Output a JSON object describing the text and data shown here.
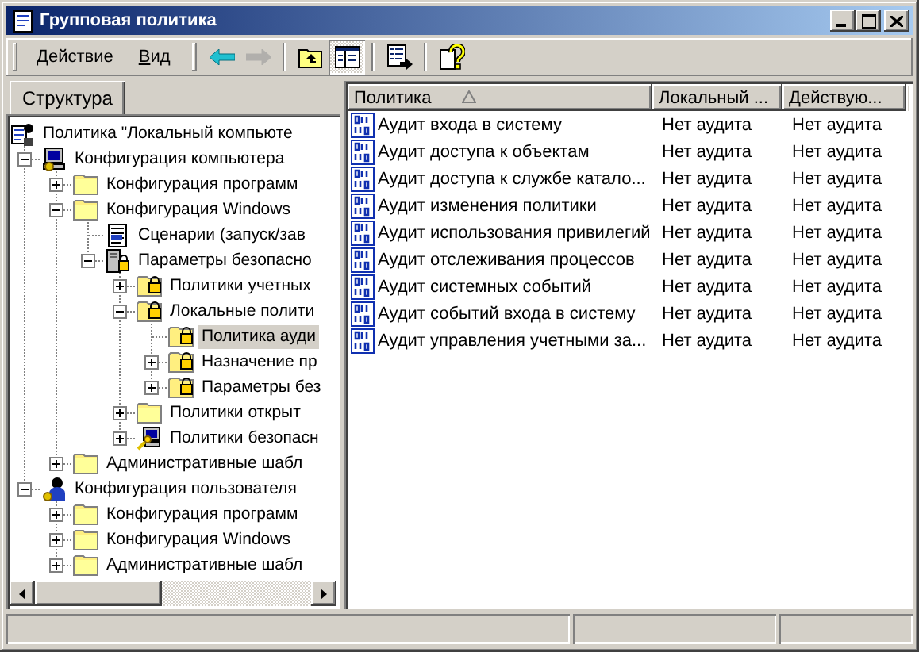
{
  "window": {
    "title": "Групповая политика"
  },
  "menu": [
    {
      "label": "Действие"
    },
    {
      "label": "Вид"
    }
  ],
  "toolbar_groups": [
    [
      {
        "kind": "back",
        "disabled": false,
        "pressed": false
      },
      {
        "kind": "forward",
        "disabled": true,
        "pressed": false
      }
    ],
    [
      {
        "kind": "up",
        "disabled": false,
        "pressed": false
      },
      {
        "kind": "tree",
        "disabled": false,
        "pressed": true
      }
    ],
    [
      {
        "kind": "export",
        "disabled": false,
        "pressed": false
      }
    ],
    [
      {
        "kind": "help",
        "disabled": false,
        "pressed": false
      }
    ]
  ],
  "tabs": [
    {
      "label": "Структура",
      "selected": true
    }
  ],
  "tree": [
    {
      "label": "Политика \"Локальный компьюте",
      "kind": "root",
      "selected": false,
      "children": [
        {
          "label": "Конфигурация компьютера",
          "kind": "computer",
          "expanded": true,
          "selected": false,
          "children": [
            {
              "label": "Конфигурация программ",
              "kind": "folder",
              "expanded": false,
              "selected": false
            },
            {
              "label": "Конфигурация Windows",
              "kind": "folder",
              "expanded": true,
              "selected": false,
              "children": [
                {
                  "label": "Сценарии (запуск/зав",
                  "kind": "script",
                  "selected": false
                },
                {
                  "label": "Параметры безопасно",
                  "kind": "security",
                  "expanded": true,
                  "selected": false,
                  "children": [
                    {
                      "label": "Политики учетных",
                      "kind": "lockfolder",
                      "expanded": false,
                      "selected": false
                    },
                    {
                      "label": "Локальные полити",
                      "kind": "lockfolder",
                      "expanded": true,
                      "selected": false,
                      "children": [
                        {
                          "label": "Политика ауди",
                          "kind": "lockfolder",
                          "selected": true
                        },
                        {
                          "label": "Назначение пр",
                          "kind": "lockfolder",
                          "expanded": false,
                          "selected": false
                        },
                        {
                          "label": "Параметры без",
                          "kind": "lockfolder",
                          "expanded": false,
                          "selected": false
                        }
                      ]
                    },
                    {
                      "label": "Политики открыт",
                      "kind": "folder",
                      "expanded": false,
                      "selected": false
                    },
                    {
                      "label": "Политики безопасн",
                      "kind": "netkey",
                      "expanded": false,
                      "selected": false
                    }
                  ]
                }
              ]
            },
            {
              "label": "Административные шабл",
              "kind": "folder",
              "expanded": false,
              "selected": false
            }
          ]
        },
        {
          "label": "Конфигурация пользователя",
          "kind": "user",
          "expanded": true,
          "selected": false,
          "children": [
            {
              "label": "Конфигурация программ",
              "kind": "folder",
              "expanded": false,
              "selected": false
            },
            {
              "label": "Конфигурация Windows",
              "kind": "folder",
              "expanded": false,
              "selected": false
            },
            {
              "label": "Административные шабл",
              "kind": "folder",
              "expanded": false,
              "selected": false
            }
          ]
        }
      ]
    }
  ],
  "list": {
    "columns": [
      {
        "label": "Политика",
        "sorted": true
      },
      {
        "label": "Локальный ...",
        "sorted": false
      },
      {
        "label": "Действую...",
        "sorted": false
      }
    ],
    "rows": [
      {
        "policy": "Аудит входа в систему",
        "local": "Нет аудита",
        "effective": "Нет аудита"
      },
      {
        "policy": "Аудит доступа к объектам",
        "local": "Нет аудита",
        "effective": "Нет аудита"
      },
      {
        "policy": "Аудит доступа к службе катало...",
        "local": "Нет аудита",
        "effective": "Нет аудита"
      },
      {
        "policy": "Аудит изменения политики",
        "local": "Нет аудита",
        "effective": "Нет аудита"
      },
      {
        "policy": "Аудит использования привилегий",
        "local": "Нет аудита",
        "effective": "Нет аудита"
      },
      {
        "policy": "Аудит отслеживания процессов",
        "local": "Нет аудита",
        "effective": "Нет аудита"
      },
      {
        "policy": "Аудит системных событий",
        "local": "Нет аудита",
        "effective": "Нет аудита"
      },
      {
        "policy": "Аудит событий входа в систему",
        "local": "Нет аудита",
        "effective": "Нет аудита"
      },
      {
        "policy": "Аудит управления учетными за...",
        "local": "Нет аудита",
        "effective": "Нет аудита"
      }
    ]
  }
}
